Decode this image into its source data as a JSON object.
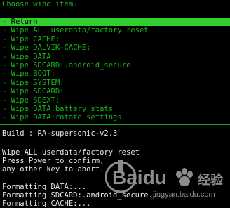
{
  "header": {
    "title": "Choose wipe item."
  },
  "menu": {
    "items": [
      {
        "label": "- Return",
        "selected": true
      },
      {
        "label": "- Wipe ALL userdata/factory reset"
      },
      {
        "label": "- Wipe CACHE:"
      },
      {
        "label": "- Wipe DALVIK-CACHE:"
      },
      {
        "label": "- Wipe DATA:"
      },
      {
        "label": "- Wipe SDCARD:.android_secure"
      },
      {
        "label": "- Wipe BOOT:"
      },
      {
        "label": "- Wipe SYSTEM:"
      },
      {
        "label": "- Wipe SDCARD:"
      },
      {
        "label": "- Wipe SDEXT:"
      },
      {
        "label": "- Wipe DATA:battery stats"
      },
      {
        "label": "- Wipe DATA:rotate settings"
      }
    ]
  },
  "log": {
    "build": "Build : RA-supersonic-v2.3",
    "wipe_title": "Wipe ALL userdata/factory reset",
    "instr1": "Press Power to confirm,",
    "instr2": "any other key to abort.",
    "fmt1": "Formatting DATA:...",
    "fmt2": "Formatting SDCARD:.android_secure...",
    "fmt3": "Formatting CACHE:..."
  },
  "watermark": {
    "brand": "Baidu",
    "cn_text": "经验",
    "url": "jingyan.baidu.com"
  },
  "colors": {
    "background": "#000000",
    "menu_text": "#14b814",
    "highlight": "#2ecf2e",
    "log_text": "#e6e6e6"
  }
}
